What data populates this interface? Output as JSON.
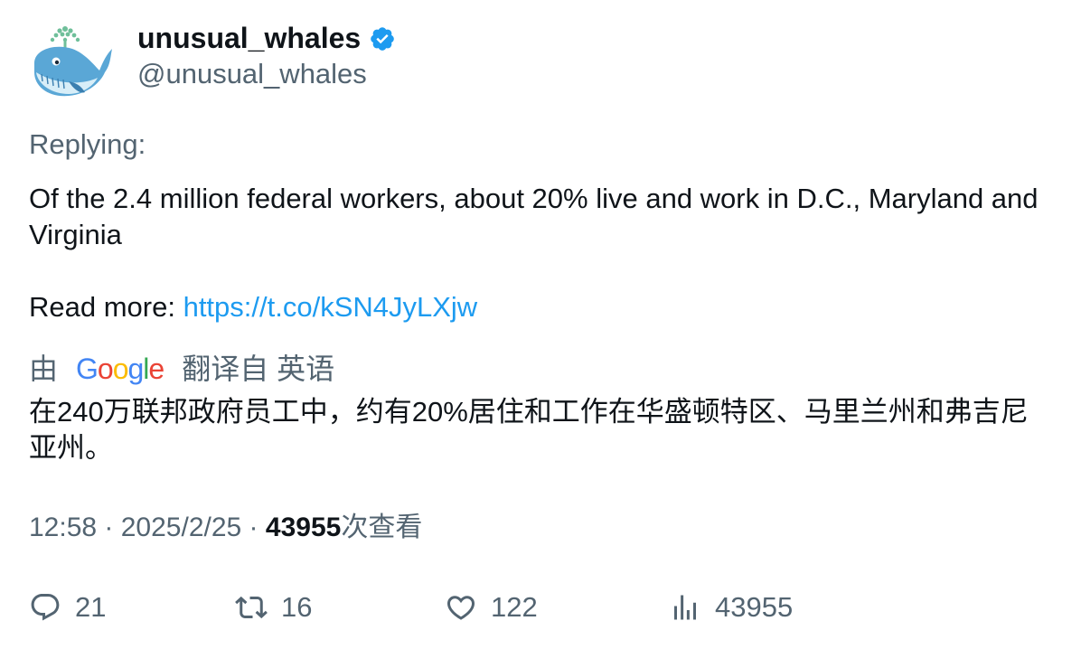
{
  "author": {
    "display_name": "unusual_whales",
    "handle": "@unusual_whales",
    "avatar_icon": "whale-avatar",
    "verified": true,
    "verified_color": "#1d9bf0"
  },
  "tweet": {
    "replying_label": "Replying:",
    "text_line1": "Of the 2.4 million federal workers, about 20% live and work in D.C., Maryland and Virginia",
    "read_more_prefix": "Read more: ",
    "link": "https://t.co/kSN4JyLXjw"
  },
  "translation": {
    "by_label": "由",
    "provider": "Google",
    "from_label": "翻译自 英语",
    "text": "在240万联邦政府员工中，约有20%居住和工作在华盛顿特区、马里兰州和弗吉尼亚州。"
  },
  "meta": {
    "time": "12:58",
    "separator": " · ",
    "date": "2025/2/25",
    "views_count": "43955",
    "views_label": "次查看"
  },
  "actions": {
    "replies": "21",
    "retweets": "16",
    "likes": "122",
    "views": "43955"
  },
  "colors": {
    "text": "#0f1419",
    "secondary": "#536471",
    "link": "#1d9bf0"
  }
}
